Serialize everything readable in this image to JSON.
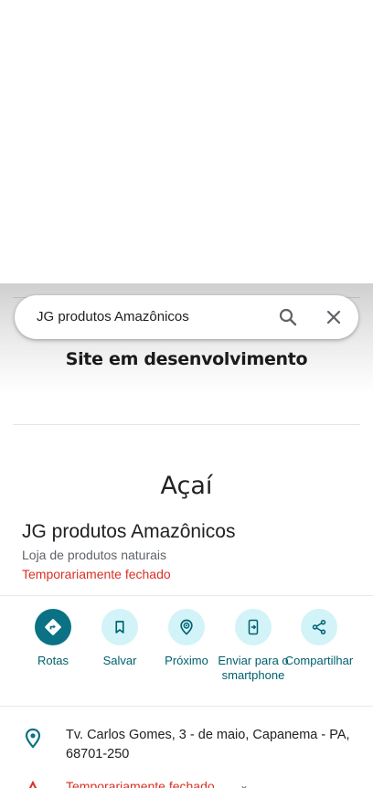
{
  "search": {
    "query": "JG produtos Amazônicos"
  },
  "photo": {
    "caption": "Site em desenvolvimento",
    "brand": "Açaí"
  },
  "place": {
    "name": "JG produtos Amazônicos",
    "category": "Loja de produtos naturais",
    "status": "Temporariamente fechado"
  },
  "actions": [
    {
      "label": "Rotas",
      "icon": "directions-icon"
    },
    {
      "label": "Salvar",
      "icon": "bookmark-icon"
    },
    {
      "label": "Próximo",
      "icon": "nearby-icon"
    },
    {
      "label": "Enviar para o smartphone",
      "icon": "send-to-phone-icon"
    },
    {
      "label": "Compartilhar",
      "icon": "share-icon"
    }
  ],
  "details": {
    "address": "Tv. Carlos Gomes, 3 - de maio, Capanema - PA, 68701-250",
    "hours": "Temporariamente fechado"
  },
  "colors": {
    "accent": "#0b7285",
    "action_bg": "#d2f3f8",
    "status_red": "#d93025"
  }
}
